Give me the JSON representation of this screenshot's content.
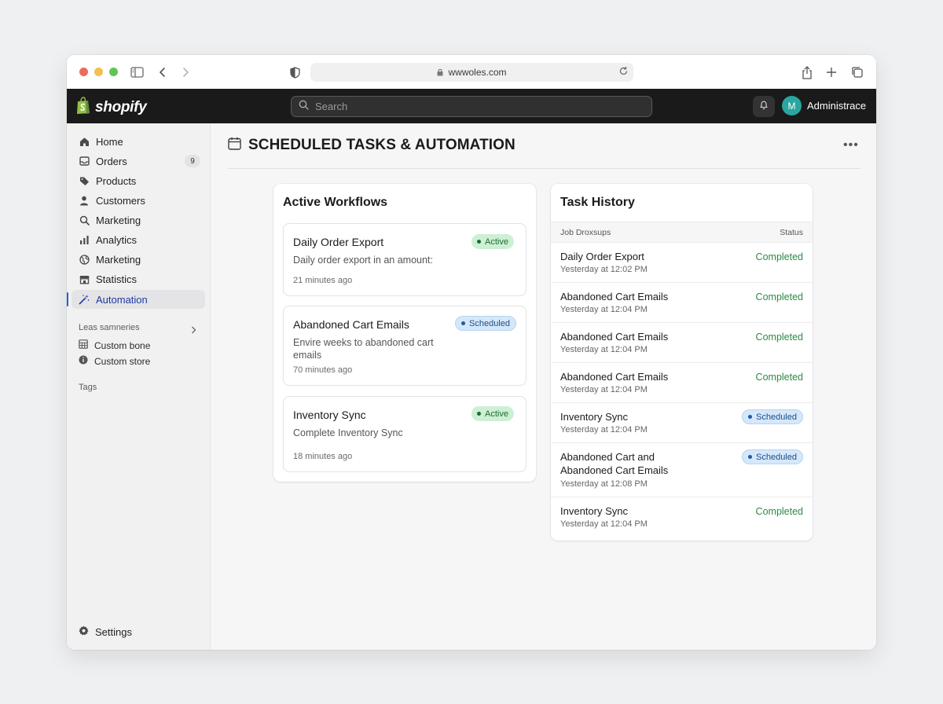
{
  "browser": {
    "url": "wwwoles.com"
  },
  "topbar": {
    "brand": "shopify",
    "search_placeholder": "Search",
    "avatar_initial": "M",
    "admin_name": "Administrace"
  },
  "sidebar": {
    "items": [
      {
        "label": "Home",
        "icon": "home-icon"
      },
      {
        "label": "Orders",
        "icon": "inbox-icon",
        "badge": "9"
      },
      {
        "label": "Products",
        "icon": "tag-icon"
      },
      {
        "label": "Customers",
        "icon": "person-icon"
      },
      {
        "label": "Marketing",
        "icon": "search-icon"
      },
      {
        "label": "Analytics",
        "icon": "bar-chart-icon"
      },
      {
        "label": "Marketing",
        "icon": "globe-icon"
      },
      {
        "label": "Statistics",
        "icon": "store-icon"
      },
      {
        "label": "Automation",
        "icon": "wand-icon",
        "active": true
      }
    ],
    "section_label": "Leas samneries",
    "sub_items": [
      {
        "label": "Custom bone",
        "icon": "grid-icon"
      },
      {
        "label": "Custom store",
        "icon": "info-icon"
      }
    ],
    "tags_label": "Tags",
    "settings_label": "Settings"
  },
  "page": {
    "title": "SCHEDULED TASKS & AUTOMATION"
  },
  "workflows": {
    "title": "Active Workflows",
    "items": [
      {
        "name": "Daily Order Export",
        "status": "Active",
        "description": "Daily order export in an amount:",
        "time": "21 minutes ago"
      },
      {
        "name": "Abandoned Cart Emails",
        "status": "Scheduled",
        "description": "Envire weeks to abandoned cart emails",
        "time": "70 minutes ago"
      },
      {
        "name": "Inventory Sync",
        "status": "Active",
        "description": "Complete Inventory Sync",
        "time": "18 minutes ago"
      }
    ]
  },
  "history": {
    "title": "Task History",
    "col_job": "Job Droxsups",
    "col_status": "Status",
    "rows": [
      {
        "name": "Daily Order Export",
        "time": "Yesterday at 12:02 PM",
        "status": "Completed"
      },
      {
        "name": "Abandoned Cart Emails",
        "time": "Yesterday at 12:04 PM",
        "status": "Completed"
      },
      {
        "name": "Abandoned Cart Emails",
        "time": "Yesterday at 12:04 PM",
        "status": "Completed"
      },
      {
        "name": "Abandoned Cart Emails",
        "time": "Yesterday at 12:04 PM",
        "status": "Completed"
      },
      {
        "name": "Inventory Sync",
        "time": "Yesterday at 12:04 PM",
        "status": "Scheduled"
      },
      {
        "name": "Abandoned Cart and Abandoned Cart Emails",
        "time": "Yesterday at 12:08 PM",
        "status": "Scheduled"
      },
      {
        "name": "Inventory Sync",
        "time": "Yesterday at 12:04 PM",
        "status": "Completed"
      }
    ]
  },
  "colors": {
    "topbar": "#1a1a1a",
    "active_badge_bg": "#cdf0d4",
    "scheduled_badge_bg": "#d5e7fa",
    "completed_text": "#2e8a43",
    "avatar": "#2aa6a0"
  }
}
